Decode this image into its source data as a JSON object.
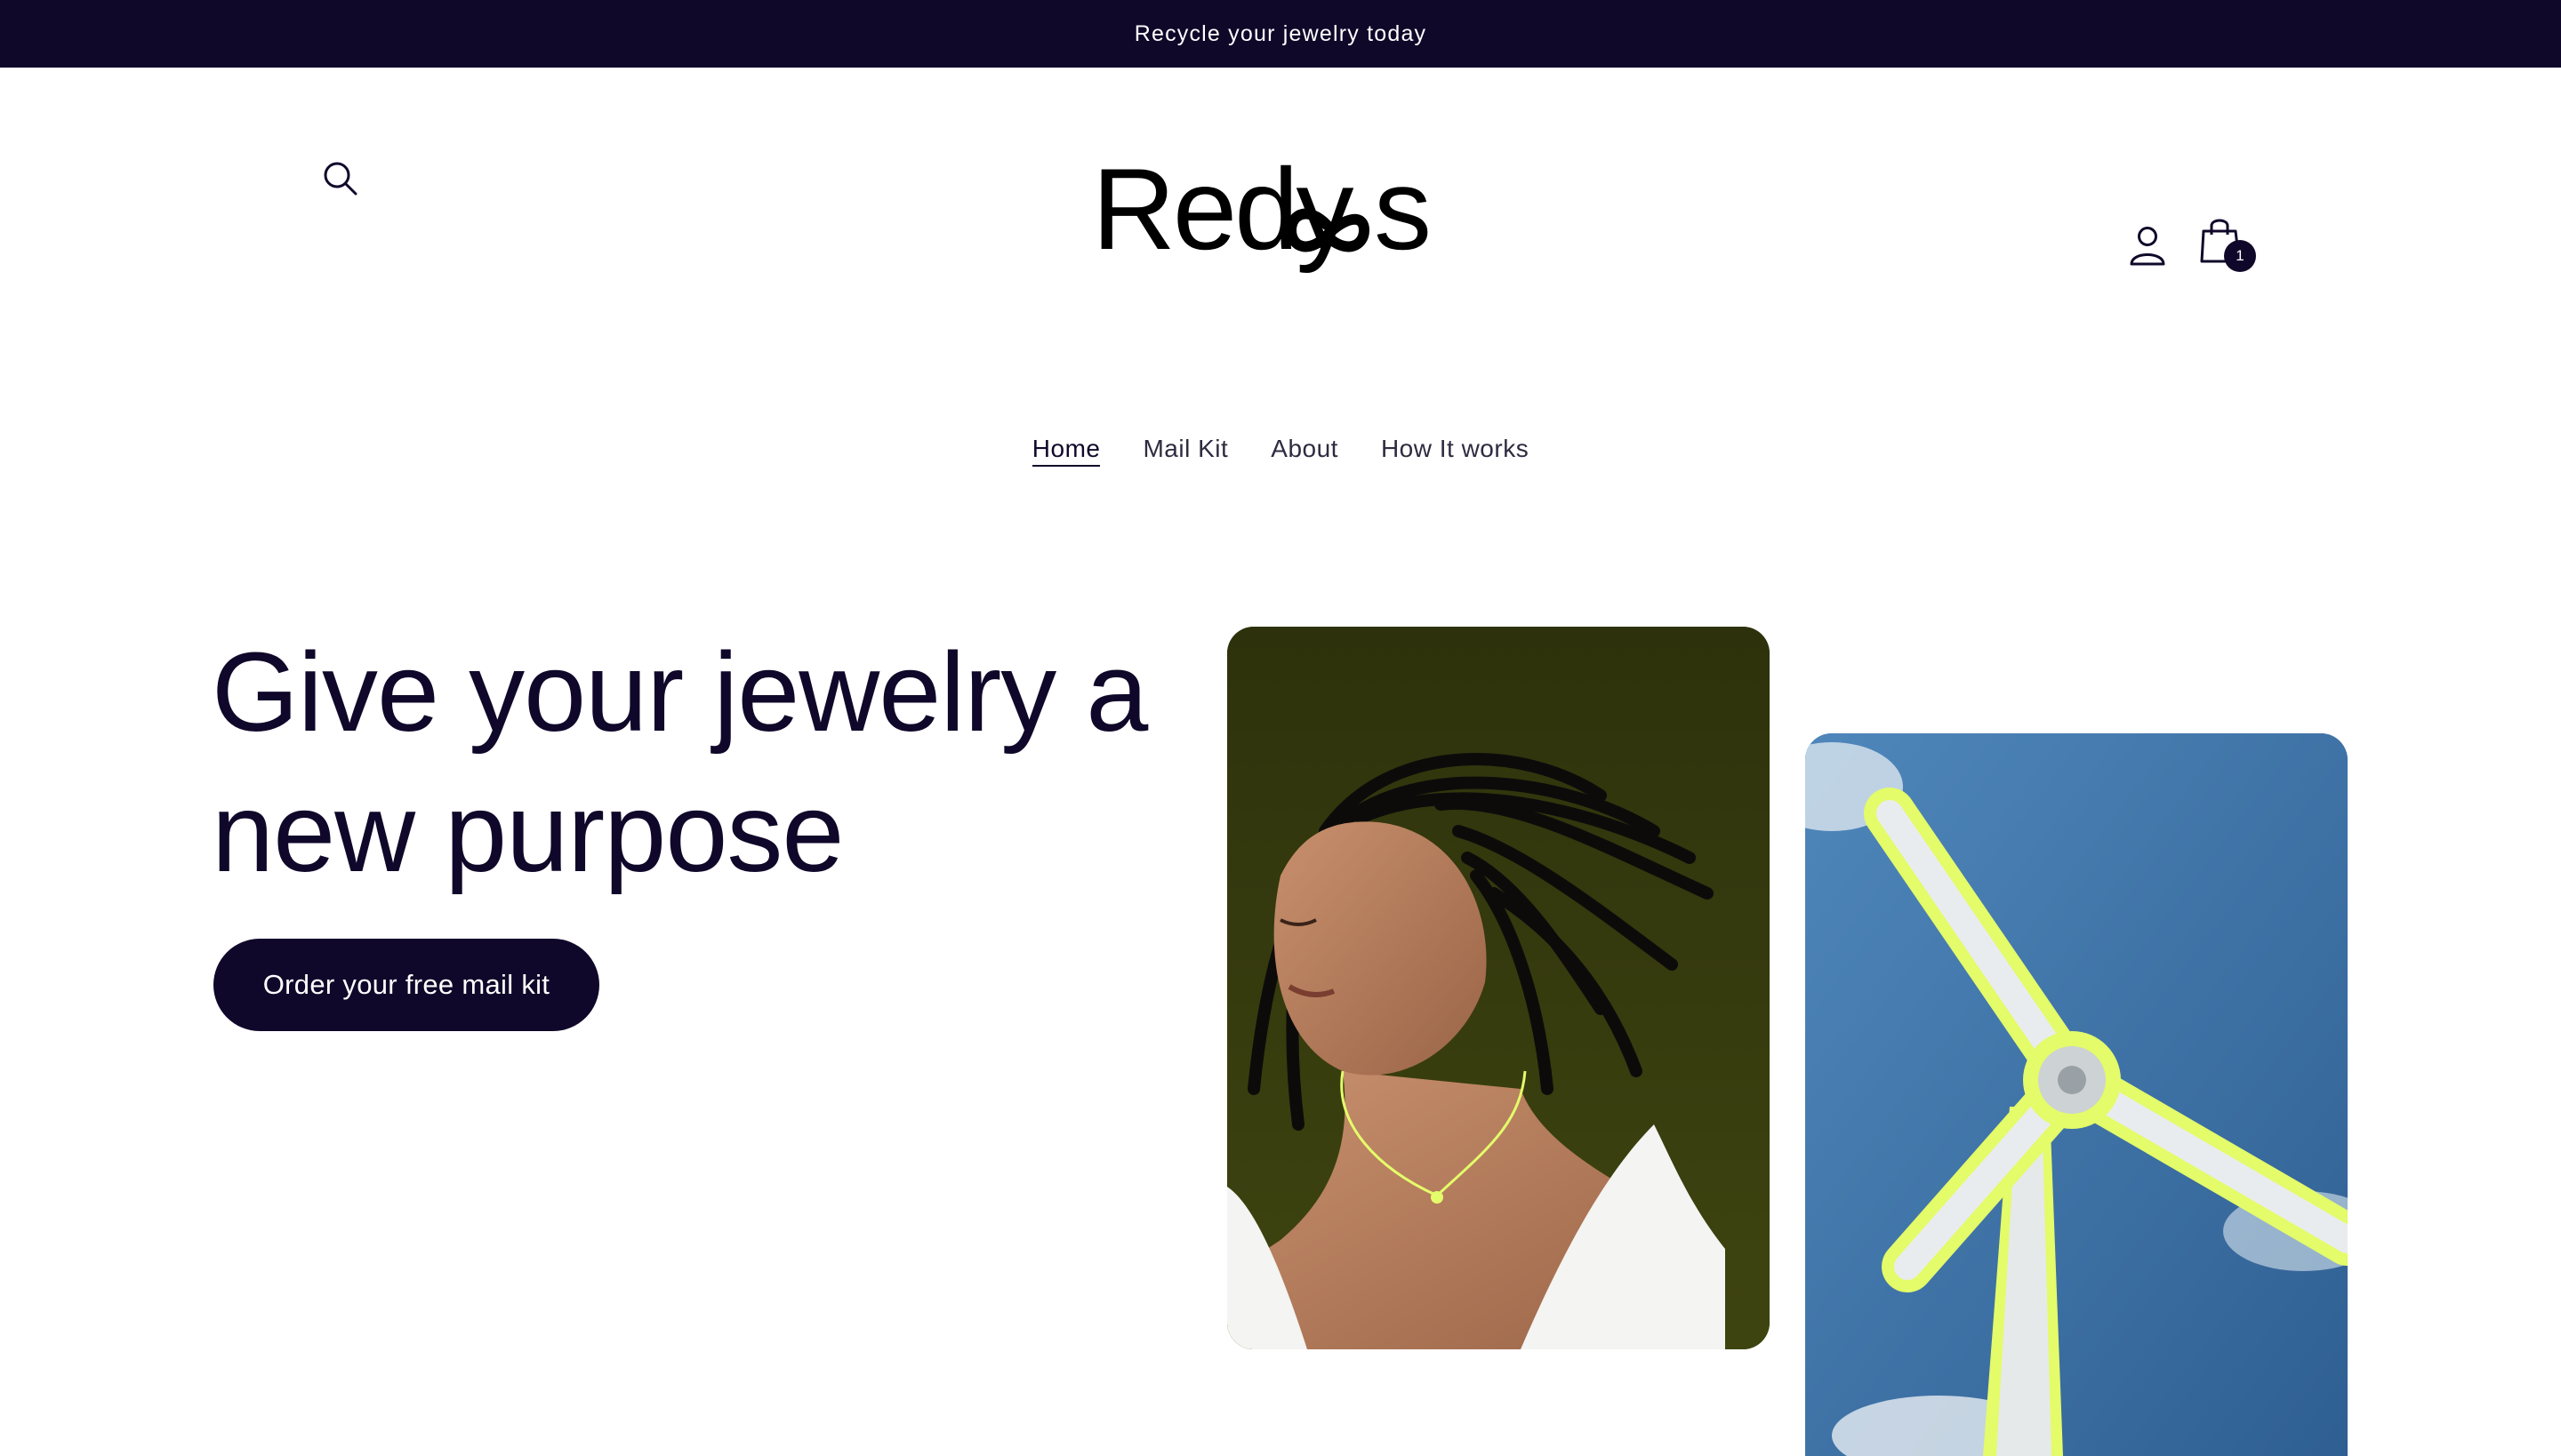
{
  "announcement": {
    "text": "Recycle your jewelry today"
  },
  "header": {
    "logo_text": "Redycas",
    "search_icon": "search-icon",
    "account_icon": "user-icon",
    "cart_icon": "shopping-bag-icon",
    "cart_count": "1"
  },
  "nav": {
    "items": [
      {
        "label": "Home",
        "active": true
      },
      {
        "label": "Mail Kit",
        "active": false
      },
      {
        "label": "About",
        "active": false
      },
      {
        "label": "How It works",
        "active": false
      }
    ]
  },
  "hero": {
    "title_line1": "Give your jewelry a",
    "title_line2": "new purpose",
    "cta_label": "Order your free mail kit"
  },
  "colors": {
    "brand_dark": "#10082a",
    "accent_lime": "#e4fb6a",
    "photo_olive": "#363a0f",
    "sky_blue": "#3e6fa0"
  }
}
